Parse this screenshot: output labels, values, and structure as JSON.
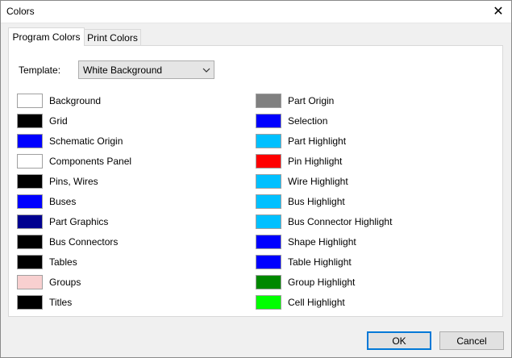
{
  "window": {
    "title": "Colors",
    "close_glyph": "✕"
  },
  "tabs": [
    {
      "label": "Program Colors",
      "active": true
    },
    {
      "label": "Print Colors",
      "active": false
    }
  ],
  "template": {
    "label": "Template:",
    "value": "White Background"
  },
  "left_colors": [
    {
      "label": "Background",
      "color": "#ffffff"
    },
    {
      "label": "Grid",
      "color": "#000000"
    },
    {
      "label": "Schematic Origin",
      "color": "#0000ff"
    },
    {
      "label": "Components Panel",
      "color": "#ffffff"
    },
    {
      "label": "Pins, Wires",
      "color": "#000000"
    },
    {
      "label": "Buses",
      "color": "#0000ff"
    },
    {
      "label": "Part Graphics",
      "color": "#000090"
    },
    {
      "label": "Bus Connectors",
      "color": "#000000"
    },
    {
      "label": "Tables",
      "color": "#000000"
    },
    {
      "label": "Groups",
      "color": "#f8d0d0"
    },
    {
      "label": "Titles",
      "color": "#000000"
    }
  ],
  "right_colors": [
    {
      "label": "Part Origin",
      "color": "#808080"
    },
    {
      "label": "Selection",
      "color": "#0000ff"
    },
    {
      "label": "Part Highlight",
      "color": "#00c0ff"
    },
    {
      "label": "Pin Highlight",
      "color": "#ff0000"
    },
    {
      "label": "Wire Highlight",
      "color": "#00c0ff"
    },
    {
      "label": "Bus Highlight",
      "color": "#00c0ff"
    },
    {
      "label": "Bus Connector Highlight",
      "color": "#00c0ff"
    },
    {
      "label": "Shape Highlight",
      "color": "#0000ff"
    },
    {
      "label": "Table Highlight",
      "color": "#0000ff"
    },
    {
      "label": "Group Highlight",
      "color": "#008800"
    },
    {
      "label": "Cell Highlight",
      "color": "#00ff00"
    }
  ],
  "buttons": {
    "ok": "OK",
    "cancel": "Cancel"
  }
}
